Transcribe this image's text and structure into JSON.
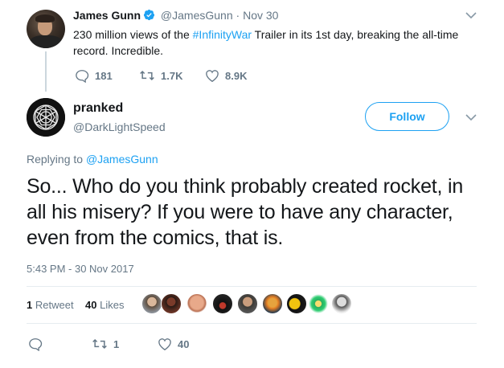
{
  "parent_tweet": {
    "name": "James Gunn",
    "handle": "@JamesGunn",
    "separator": "·",
    "date": "Nov 30",
    "text_before": "230 million views of the ",
    "hashtag": "#InfinityWar",
    "text_after": " Trailer in its 1st day, breaking the all-time record. Incredible.",
    "replies": "181",
    "retweets": "1.7K",
    "likes": "8.9K"
  },
  "main_tweet": {
    "name": "pranked",
    "handle": "@DarkLightSpeed",
    "follow_label": "Follow",
    "replying_prefix": "Replying to",
    "replying_to": "@JamesGunn",
    "text": "So... Who do you think probably created rocket, in all his misery? If you were to have any character, even from the comics, that is.",
    "timestamp": "5:43 PM - 30 Nov 2017",
    "retweet_count": "1",
    "retweet_label": "Retweet",
    "like_count": "40",
    "like_label": "Likes",
    "action_retweets": "1",
    "action_likes": "40"
  },
  "liker_avatars": [
    "liker-1",
    "liker-2",
    "liker-3",
    "liker-4",
    "liker-5",
    "liker-6",
    "liker-7",
    "liker-8",
    "liker-9"
  ],
  "colors": {
    "accent": "#1da1f2",
    "secondary_text": "#657786",
    "primary_text": "#14171a",
    "divider": "#e6ecf0"
  }
}
